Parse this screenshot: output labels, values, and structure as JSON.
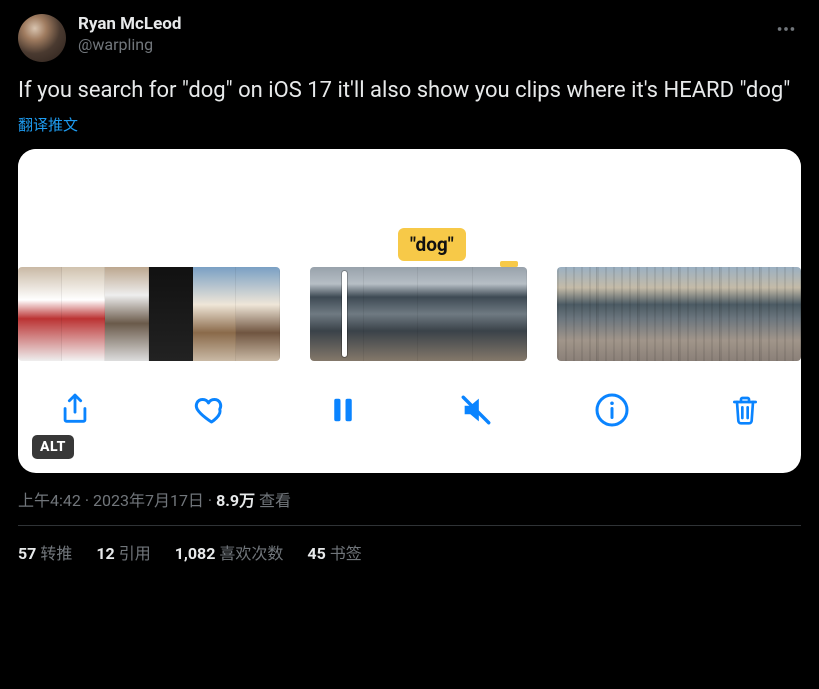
{
  "author": {
    "displayName": "Ryan McLeod",
    "handle": "@warpling"
  },
  "tweetText": "If you search for \"dog\" on iOS 17 it'll also show you clips where it's HEARD \"dog\"",
  "translateLabel": "翻译推文",
  "media": {
    "searchTag": "\"dog\"",
    "altBadge": "ALT"
  },
  "meta": {
    "time": "上午4:42",
    "dot1": " · ",
    "date": "2023年7月17日",
    "dot2": " · ",
    "viewsNum": "8.9万",
    "viewsLabel": " 查看"
  },
  "stats": {
    "retweets": {
      "num": "57",
      "label": "转推"
    },
    "quotes": {
      "num": "12",
      "label": "引用"
    },
    "likes": {
      "num": "1,082",
      "label": "喜欢次数"
    },
    "bookmarks": {
      "num": "45",
      "label": "书签"
    }
  }
}
